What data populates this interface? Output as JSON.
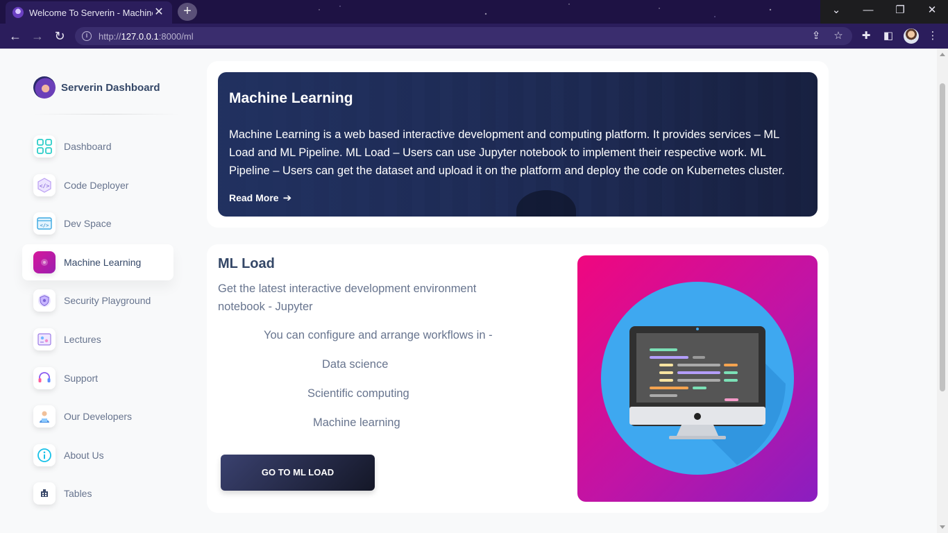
{
  "browser": {
    "tab_title": "Welcome To Serverin - Machine L",
    "url_prefix": "http://",
    "url_host": "127.0.0.1",
    "url_rest": ":8000/ml"
  },
  "sidebar": {
    "brand": "Serverin Dashboard",
    "items": [
      {
        "label": "Dashboard",
        "icon": "dashboard-icon"
      },
      {
        "label": "Code Deployer",
        "icon": "code-deployer-icon"
      },
      {
        "label": "Dev Space",
        "icon": "dev-space-icon"
      },
      {
        "label": "Machine Learning",
        "icon": "machine-learning-icon",
        "active": true
      },
      {
        "label": "Security Playground",
        "icon": "security-icon"
      },
      {
        "label": "Lectures",
        "icon": "lectures-icon"
      },
      {
        "label": "Support",
        "icon": "headset-icon"
      },
      {
        "label": "Our Developers",
        "icon": "developer-icon"
      },
      {
        "label": "About Us",
        "icon": "info-icon"
      },
      {
        "label": "Tables",
        "icon": "tables-icon"
      }
    ]
  },
  "hero": {
    "title": "Machine Learning",
    "description": "Machine Learning is a web based interactive development and computing platform. It provides services – ML Load and ML Pipeline. ML Load – Users can use Jupyter notebook to implement their respective work. ML Pipeline – Users can get the dataset and upload it on the platform and deploy the code on Kubernetes cluster.",
    "read_more": "Read More"
  },
  "ml_load": {
    "title": "ML Load",
    "lead": "Get the latest interactive development environment notebook - Jupyter",
    "intro": "You can configure and arrange workflows in -",
    "workflows": [
      "Data science",
      "Scientific computing",
      "Machine learning"
    ],
    "button": "GO TO ML LOAD"
  },
  "colors": {
    "accent": "#cb0c9f",
    "text_dark": "#344767",
    "text_muted": "#67748e"
  }
}
